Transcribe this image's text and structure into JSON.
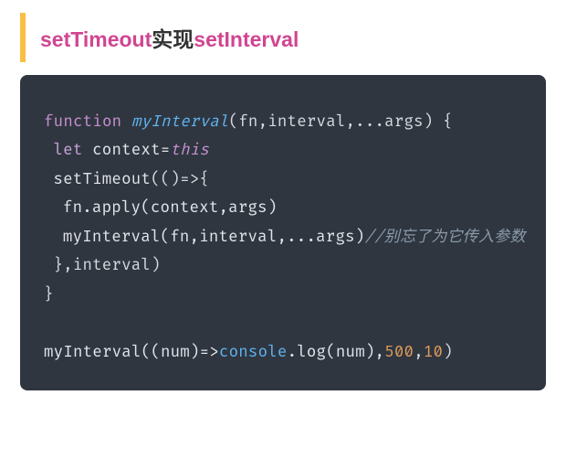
{
  "heading": {
    "prefix": "setTimeout",
    "mid": "实现",
    "suffix": "setInterval"
  },
  "code": {
    "l1": {
      "kw": "function",
      "name": " myInterval",
      "rest": "(fn,interval,...args) {"
    },
    "l2": {
      "kw": "let",
      "mid": " context=",
      "this": "this"
    },
    "l3": {
      "call": "setTimeout",
      "rest": "(()=>{"
    },
    "l4": {
      "text": "fn.apply(context,args)"
    },
    "l5": {
      "call": "myInterval(fn,interval,...args)",
      "comment": "//别忘了为它传入参数"
    },
    "l6": {
      "text": "},interval)"
    },
    "l7": {
      "text": "}"
    },
    "l8": {
      "p1": "myInterval((num)=>",
      "console": "console",
      "p2": ".log(num),",
      "n1": "500",
      "comma": ",",
      "n2": "10",
      "p3": ")"
    }
  }
}
